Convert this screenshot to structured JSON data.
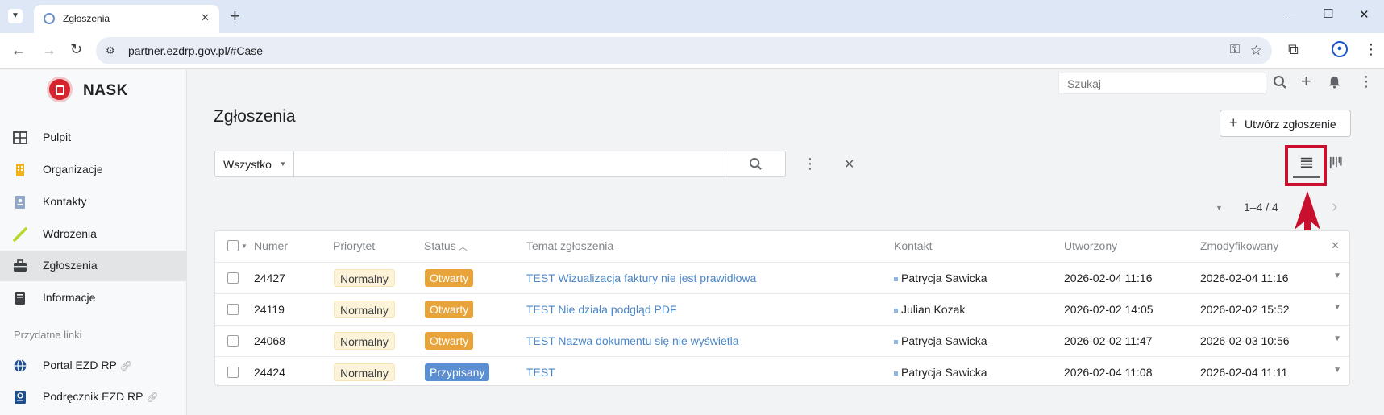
{
  "browser": {
    "tab_title": "Zgłoszenia",
    "new_tab": "+",
    "url": "partner.ezdrp.gov.pl/#Case",
    "window_controls": {
      "minimize": "—",
      "maximize": "☐",
      "close": "✕"
    }
  },
  "app": {
    "logo_text": "NASK",
    "search_placeholder": "Szukaj",
    "sidebar": {
      "items": [
        {
          "label": "Pulpit",
          "icon": "dashboard-icon"
        },
        {
          "label": "Organizacje",
          "icon": "building-icon"
        },
        {
          "label": "Kontakty",
          "icon": "contact-card-icon"
        },
        {
          "label": "Wdrożenia",
          "icon": "pencil-icon"
        },
        {
          "label": "Zgłoszenia",
          "icon": "briefcase-icon",
          "active": true
        },
        {
          "label": "Informacje",
          "icon": "book-icon"
        }
      ],
      "section_title": "Przydatne linki",
      "links": [
        {
          "label": "Portal EZD RP",
          "icon": "globe-icon"
        },
        {
          "label": "Podręcznik EZD RP",
          "icon": "manual-icon"
        }
      ]
    },
    "page": {
      "title": "Zgłoszenia",
      "create_button": "Utwórz zgłoszenie",
      "filter_select": "Wszystko",
      "pagination": "1–4 / 4"
    },
    "table": {
      "columns": [
        "Numer",
        "Priorytet",
        "Status",
        "Temat zgłoszenia",
        "Kontakt",
        "Utworzony",
        "Zmodyfikowany"
      ],
      "rows": [
        {
          "number": "24427",
          "priority": "Normalny",
          "status": "Otwarty",
          "status_color": "#e8a43b",
          "subject": "TEST Wizualizacja faktury nie jest prawidłowa",
          "contact": "Patrycja Sawicka",
          "created": "2026-02-04 11:16",
          "modified": "2026-02-04 11:16"
        },
        {
          "number": "24119",
          "priority": "Normalny",
          "status": "Otwarty",
          "status_color": "#e8a43b",
          "subject": "TEST Nie działa podgląd PDF",
          "contact": "Julian Kozak",
          "created": "2026-02-02 14:05",
          "modified": "2026-02-02 15:52"
        },
        {
          "number": "24068",
          "priority": "Normalny",
          "status": "Otwarty",
          "status_color": "#e8a43b",
          "subject": "TEST Nazwa dokumentu się nie wyświetla",
          "contact": "Patrycja Sawicka",
          "created": "2026-02-02 11:47",
          "modified": "2026-02-03 10:56"
        },
        {
          "number": "24424",
          "priority": "Normalny",
          "status": "Przypisany",
          "status_color": "#5b8fd4",
          "subject": "TEST",
          "contact": "Patrycja Sawicka",
          "created": "2026-02-04 11:08",
          "modified": "2026-02-04 11:11"
        }
      ]
    }
  },
  "colors": {
    "highlight": "#c8102e",
    "accent_link": "#4a86c8",
    "sidebar_active": "#e3e4e6"
  }
}
